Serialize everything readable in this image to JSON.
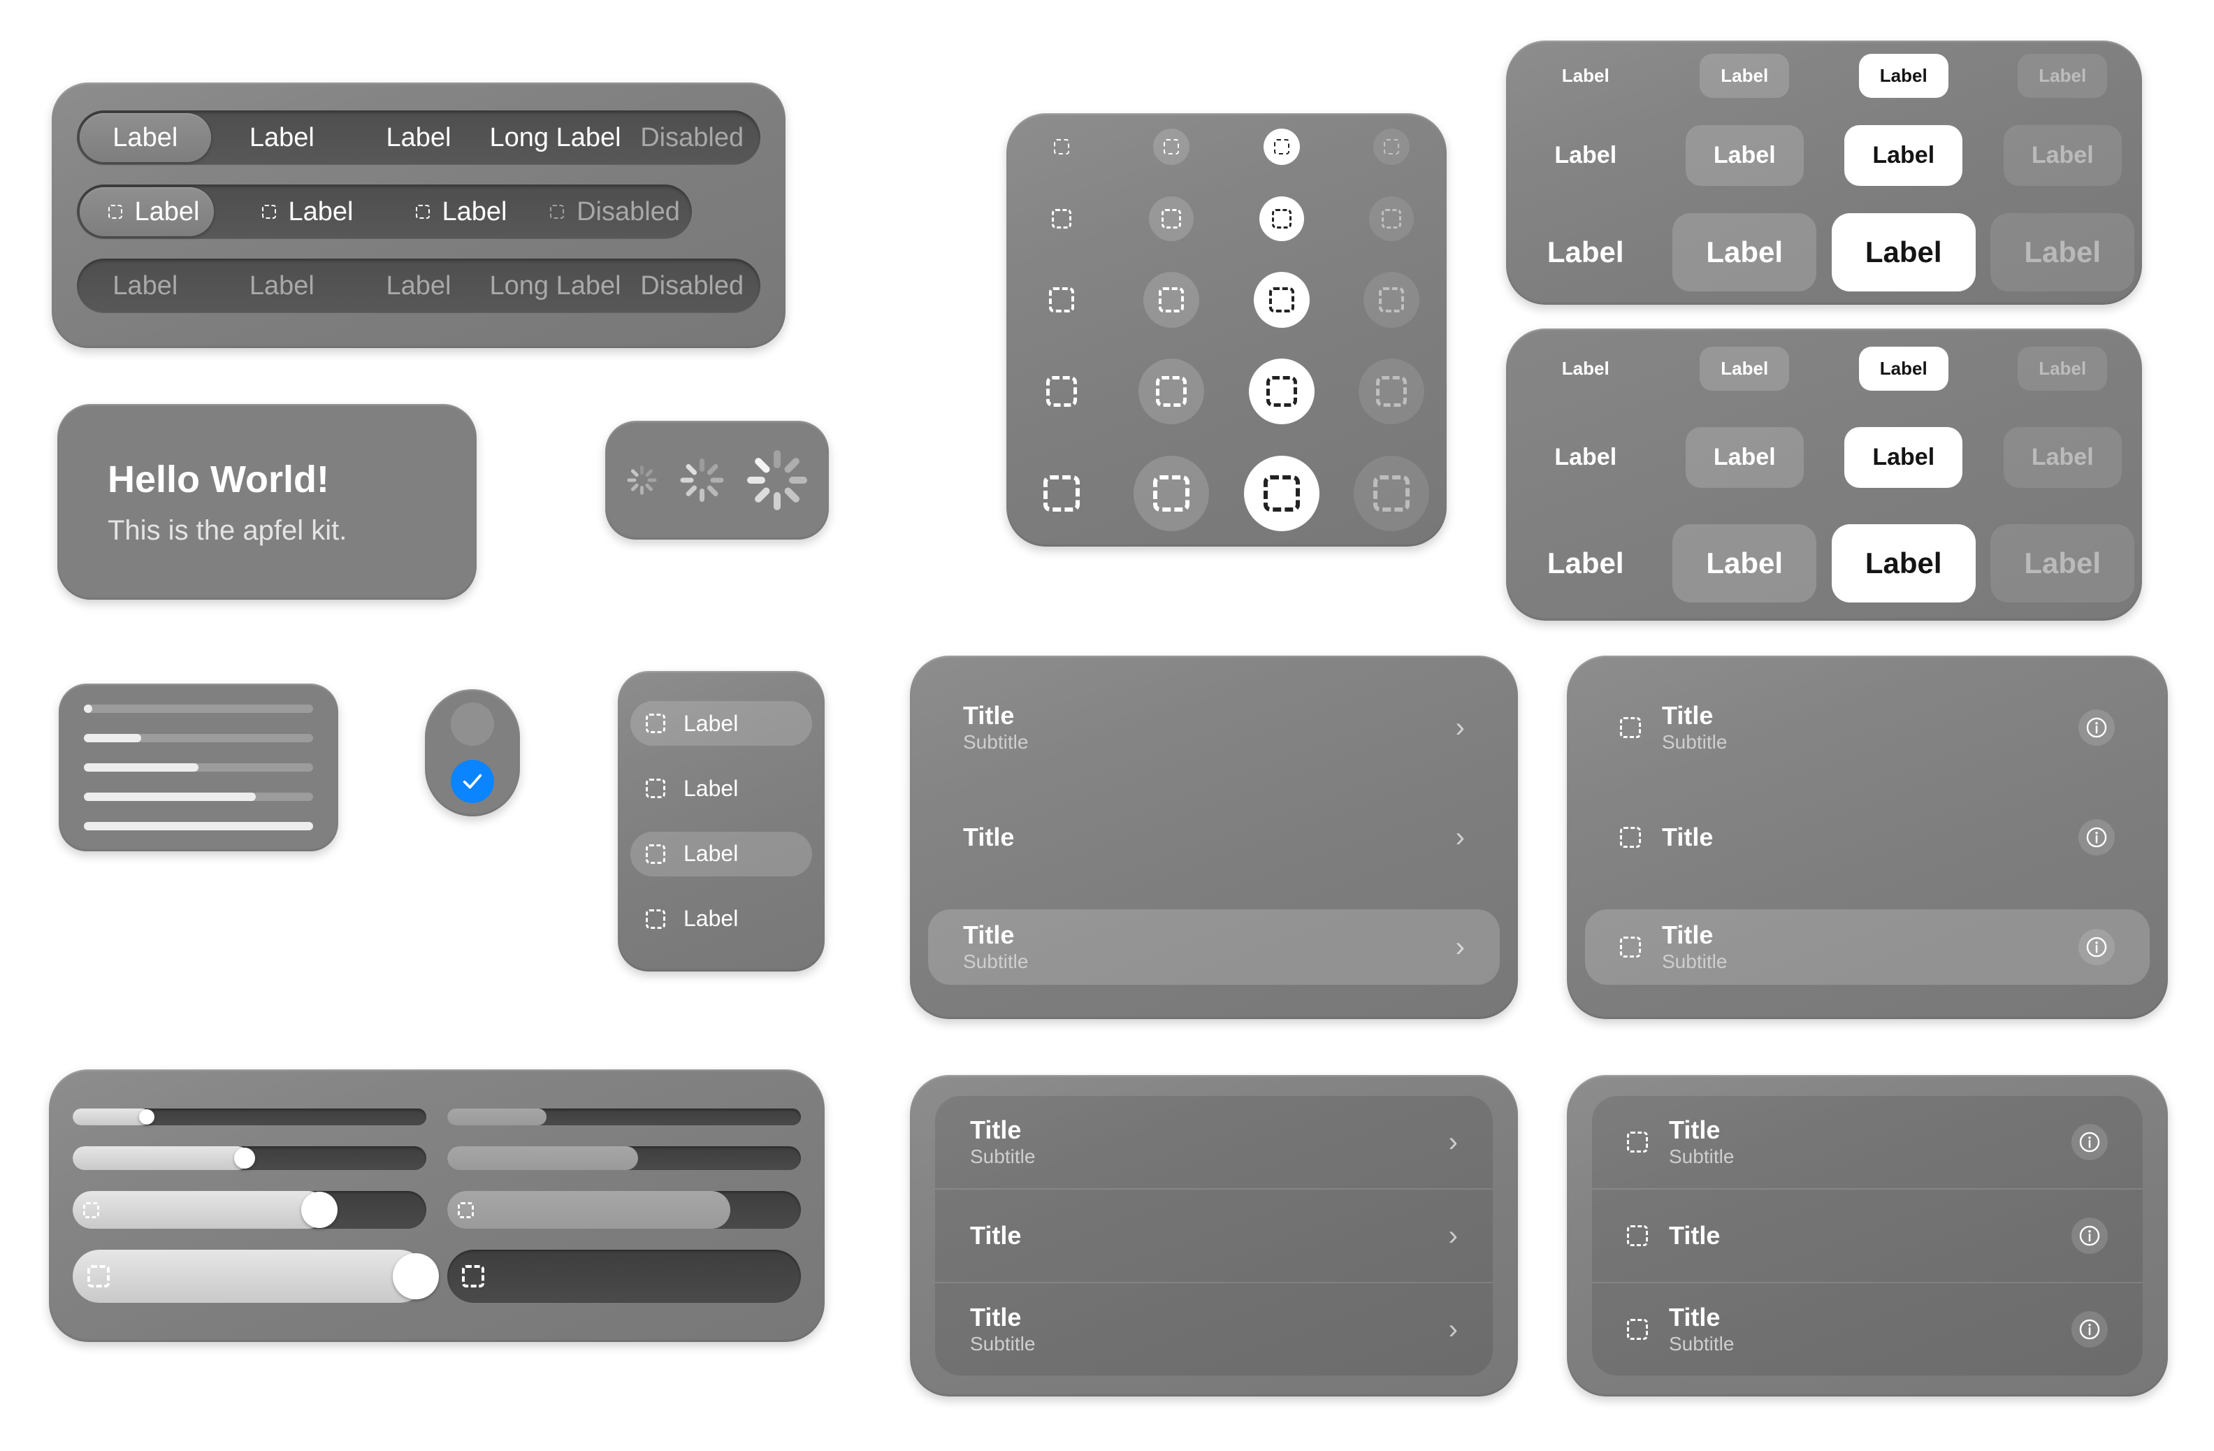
{
  "theme": {
    "panel_gray": "#808080",
    "track_dark": "#4e4e4e",
    "accent_blue": "#0a84ff",
    "text_primary": "#ffffff",
    "text_secondary": "#cfcfcf",
    "text_disabled": "#a8a8a8",
    "solid_fill": "#ffffff"
  },
  "segmented": {
    "rows": [
      {
        "id": "plain",
        "has_icon": false,
        "muted": false,
        "selected_index": 0,
        "items": [
          {
            "label": "Label",
            "disabled": false
          },
          {
            "label": "Label",
            "disabled": false
          },
          {
            "label": "Label",
            "disabled": false
          },
          {
            "label": "Long Label",
            "disabled": false
          },
          {
            "label": "Disabled",
            "disabled": true
          }
        ]
      },
      {
        "id": "with-icon",
        "has_icon": true,
        "muted": false,
        "selected_index": 0,
        "items": [
          {
            "label": "Label",
            "disabled": false
          },
          {
            "label": "Label",
            "disabled": false
          },
          {
            "label": "Label",
            "disabled": false
          },
          {
            "label": "Disabled",
            "disabled": true
          }
        ]
      },
      {
        "id": "disabled-row",
        "has_icon": false,
        "muted": true,
        "selected_index": -1,
        "items": [
          {
            "label": "Label",
            "disabled": true
          },
          {
            "label": "Label",
            "disabled": true
          },
          {
            "label": "Label",
            "disabled": true
          },
          {
            "label": "Long Label",
            "disabled": true
          },
          {
            "label": "Disabled",
            "disabled": true
          }
        ]
      }
    ]
  },
  "hello_card": {
    "title": "Hello World!",
    "subtitle": "This is the apfel kit."
  },
  "spinners": {
    "items": [
      {
        "name": "spinner-small",
        "size": 42,
        "opacity": 0.55
      },
      {
        "name": "spinner-medium",
        "size": 62,
        "opacity": 0.75
      },
      {
        "name": "spinner-large",
        "size": 86,
        "opacity": 0.9
      }
    ]
  },
  "icon_grid": {
    "icon_name": "placeholder-square-icon",
    "column_styles": [
      "plain",
      "tint",
      "solid",
      "disabled"
    ],
    "rows": [
      {
        "icon": 22,
        "button": 52
      },
      {
        "icon": 28,
        "button": 64
      },
      {
        "icon": 36,
        "button": 80
      },
      {
        "icon": 44,
        "button": 94
      },
      {
        "icon": 52,
        "button": 108
      }
    ]
  },
  "button_matrix": {
    "label": "Label",
    "column_styles": [
      "plain",
      "tint",
      "solid",
      "disabled"
    ],
    "panels": [
      {
        "id": "matrix-top",
        "rows": [
          {
            "font": 26,
            "pad_x": 30,
            "pad_y": 16,
            "radius": 18
          },
          {
            "font": 34,
            "pad_x": 40,
            "pad_y": 24,
            "radius": 22
          },
          {
            "font": 42,
            "pad_x": 48,
            "pad_y": 32,
            "radius": 26
          }
        ]
      },
      {
        "id": "matrix-bottom",
        "rows": [
          {
            "font": 26,
            "pad_x": 30,
            "pad_y": 16,
            "radius": 18
          },
          {
            "font": 34,
            "pad_x": 40,
            "pad_y": 24,
            "radius": 22
          },
          {
            "font": 42,
            "pad_x": 48,
            "pad_y": 32,
            "radius": 26
          }
        ]
      }
    ]
  },
  "progress_card": {
    "bars": [
      {
        "value": 2
      },
      {
        "value": 25
      },
      {
        "value": 50
      },
      {
        "value": 75
      },
      {
        "value": 100
      }
    ]
  },
  "radio_group": {
    "options": [
      {
        "id": "radio-off",
        "selected": false
      },
      {
        "id": "radio-on",
        "selected": true
      }
    ]
  },
  "menu_list": {
    "items": [
      {
        "label": "Label",
        "highlighted": true
      },
      {
        "label": "Label",
        "highlighted": false
      },
      {
        "label": "Label",
        "highlighted": true
      },
      {
        "label": "Label",
        "highlighted": false
      }
    ]
  },
  "sliders": {
    "left_column": [
      {
        "id": "slider-xs",
        "height": 24,
        "value": 22,
        "thumb": 22,
        "has_icon": false
      },
      {
        "id": "slider-sm",
        "height": 34,
        "value": 50,
        "thumb": 30,
        "has_icon": false
      },
      {
        "id": "slider-md",
        "height": 54,
        "value": 72,
        "thumb": 52,
        "has_icon": true
      },
      {
        "id": "slider-lg",
        "height": 76,
        "value": 100,
        "thumb": 66,
        "has_icon": true
      }
    ],
    "right_column": [
      {
        "id": "progress-xs",
        "height": 24,
        "value": 28,
        "has_icon": false
      },
      {
        "id": "progress-sm",
        "height": 34,
        "value": 54,
        "has_icon": false
      },
      {
        "id": "progress-md",
        "height": 54,
        "value": 80,
        "has_icon": true
      },
      {
        "id": "progress-lg",
        "height": 76,
        "value": 0,
        "has_icon": true
      }
    ]
  },
  "lists": {
    "panel_a": {
      "id": "list-plain-floating",
      "inset": false,
      "leading_icon": false,
      "trailing": "chevron",
      "rows": [
        {
          "title": "Title",
          "subtitle": "Subtitle",
          "highlighted": false
        },
        {
          "title": "Title",
          "subtitle": "",
          "highlighted": false
        },
        {
          "title": "Title",
          "subtitle": "Subtitle",
          "highlighted": true
        }
      ]
    },
    "panel_b": {
      "id": "list-icon-floating",
      "inset": false,
      "leading_icon": true,
      "trailing": "info",
      "rows": [
        {
          "title": "Title",
          "subtitle": "Subtitle",
          "highlighted": false
        },
        {
          "title": "Title",
          "subtitle": "",
          "highlighted": false
        },
        {
          "title": "Title",
          "subtitle": "Subtitle",
          "highlighted": true
        }
      ]
    },
    "panel_c": {
      "id": "list-plain-inset",
      "inset": true,
      "leading_icon": false,
      "trailing": "chevron",
      "rows": [
        {
          "title": "Title",
          "subtitle": "Subtitle",
          "highlighted": false
        },
        {
          "title": "Title",
          "subtitle": "",
          "highlighted": false
        },
        {
          "title": "Title",
          "subtitle": "Subtitle",
          "highlighted": false
        }
      ]
    },
    "panel_d": {
      "id": "list-icon-inset",
      "inset": true,
      "leading_icon": true,
      "trailing": "info",
      "rows": [
        {
          "title": "Title",
          "subtitle": "Subtitle",
          "highlighted": false
        },
        {
          "title": "Title",
          "subtitle": "",
          "highlighted": false
        },
        {
          "title": "Title",
          "subtitle": "Subtitle",
          "highlighted": false
        }
      ]
    }
  },
  "icons": {
    "placeholder_square": "placeholder-square-icon",
    "chevron_right": "chevron-right-icon",
    "info_circle": "info-circle-icon",
    "checkmark": "checkmark-icon",
    "spinner": "spinner-icon"
  }
}
